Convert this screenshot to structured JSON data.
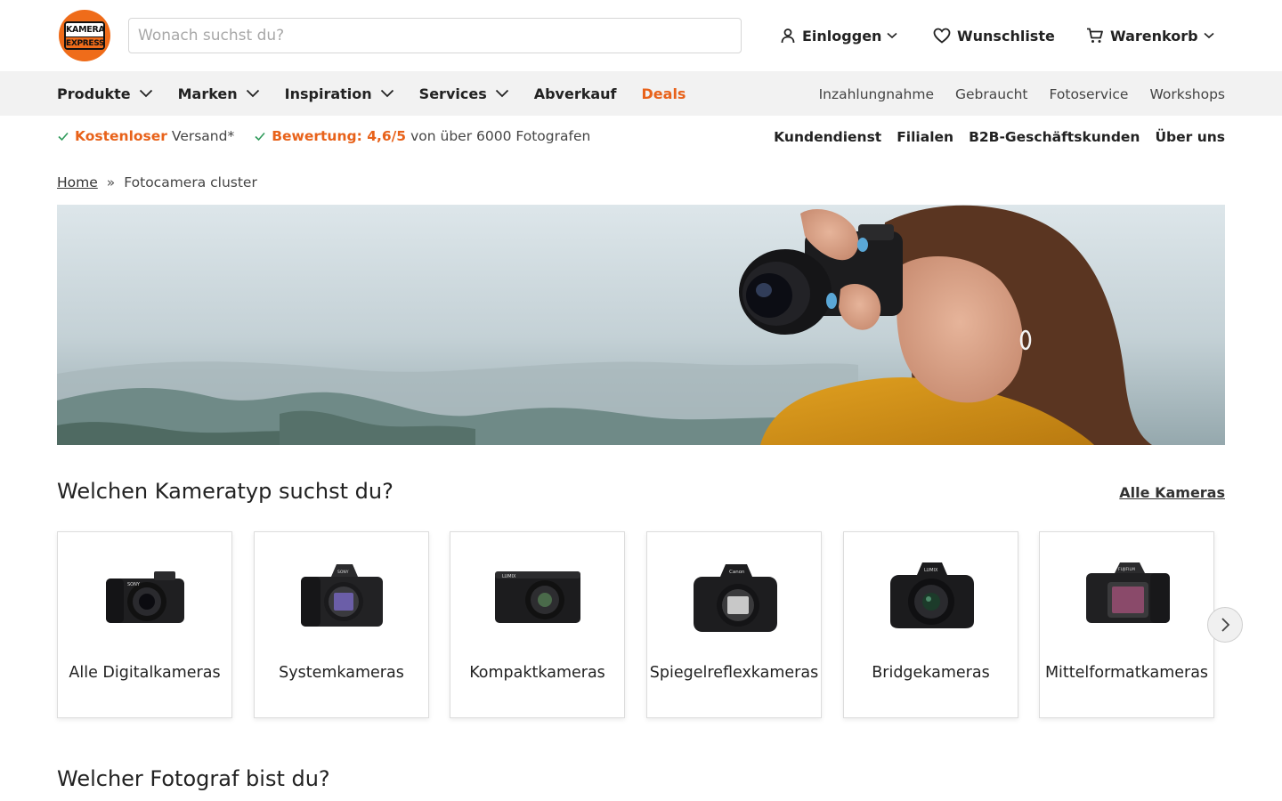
{
  "header": {
    "logo": {
      "line1": "KAMERA",
      "line2": "EXPRESS"
    },
    "search_placeholder": "Wonach suchst du?",
    "login_label": "Einloggen",
    "wishlist_label": "Wunschliste",
    "cart_label": "Warenkorb"
  },
  "nav": {
    "items": [
      {
        "label": "Produkte",
        "dropdown": true
      },
      {
        "label": "Marken",
        "dropdown": true
      },
      {
        "label": "Inspiration",
        "dropdown": true
      },
      {
        "label": "Services",
        "dropdown": true
      },
      {
        "label": "Abverkauf",
        "dropdown": false
      },
      {
        "label": "Deals",
        "dropdown": false
      }
    ],
    "links": [
      "Inzahlungnahme",
      "Gebraucht",
      "Fotoservice",
      "Workshops"
    ]
  },
  "usp": {
    "shipping_highlight": "Kostenloser",
    "shipping_rest": "Versand*",
    "rating_highlight": "Bewertung: 4,6/5",
    "rating_rest": "von über 6000 Fotografen"
  },
  "meta_links": [
    "Kundendienst",
    "Filialen",
    "B2B-Geschäftskunden",
    "Über uns"
  ],
  "breadcrumb": {
    "home": "Home",
    "separator": "»",
    "current": "Fotocamera cluster"
  },
  "section_camera_types": {
    "title": "Welchen Kameratyp suchst du?",
    "all_link": "Alle Kameras",
    "cards": [
      {
        "label": "Alle Digitalkameras",
        "icon": "mirrorless-camera-with-lens-icon"
      },
      {
        "label": "Systemkameras",
        "icon": "mirrorless-camera-body-icon"
      },
      {
        "label": "Kompaktkameras",
        "icon": "compact-camera-icon"
      },
      {
        "label": "Spiegelreflexkameras",
        "icon": "dslr-camera-body-icon"
      },
      {
        "label": "Bridgekameras",
        "icon": "bridge-camera-icon"
      },
      {
        "label": "Mittelformatkameras",
        "icon": "medium-format-camera-icon"
      }
    ]
  },
  "section_photographer": {
    "title": "Welcher Fotograf bist du?"
  },
  "colors": {
    "accent": "#e8621a",
    "nav_bg": "#f2f2f2",
    "text": "#222222",
    "check": "#2e9a5a"
  }
}
